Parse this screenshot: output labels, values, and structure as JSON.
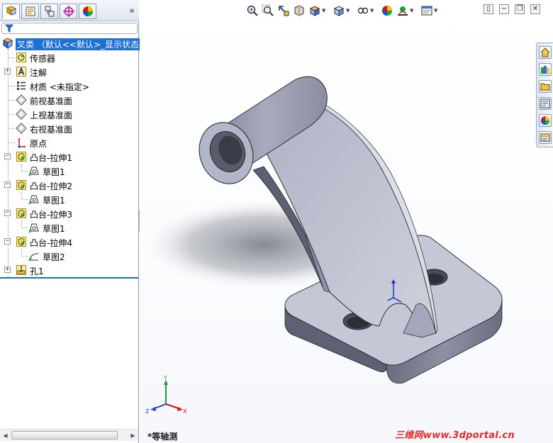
{
  "tabs": [
    {
      "name": "featuremanager-tab",
      "icon": "feature-tree-icon"
    },
    {
      "name": "propertymanager-tab",
      "icon": "property-icon"
    },
    {
      "name": "configuration-tab",
      "icon": "configuration-icon"
    },
    {
      "name": "dimxpert-tab",
      "icon": "dimxpert-icon"
    },
    {
      "name": "appearance-tab",
      "icon": "appearance-icon"
    }
  ],
  "tree": {
    "root_label": "叉类 （默认<<默认>_显示状态",
    "items": [
      {
        "label": "传感器",
        "icon": "sensor-icon",
        "level": 1,
        "expander": false
      },
      {
        "label": "注解",
        "icon": "annotation-icon",
        "level": 1,
        "expander": true
      },
      {
        "label": "材质 <未指定>",
        "icon": "material-icon",
        "level": 1,
        "expander": false
      },
      {
        "label": "前视基准面",
        "icon": "plane-icon",
        "level": 1,
        "expander": false
      },
      {
        "label": "上视基准面",
        "icon": "plane-icon",
        "level": 1,
        "expander": false
      },
      {
        "label": "右视基准面",
        "icon": "plane-icon",
        "level": 1,
        "expander": false
      },
      {
        "label": "原点",
        "icon": "origin-icon",
        "level": 1,
        "expander": false
      },
      {
        "label": "凸台-拉伸1",
        "icon": "extrude-icon",
        "level": 1,
        "expander": true
      },
      {
        "label": "草图1",
        "icon": "sketch-icon",
        "level": 2,
        "expander": false
      },
      {
        "label": "凸台-拉伸2",
        "icon": "extrude-icon",
        "level": 1,
        "expander": true
      },
      {
        "label": "草图1",
        "icon": "sketch-icon",
        "level": 2,
        "expander": false
      },
      {
        "label": "凸台-拉伸3",
        "icon": "extrude-icon",
        "level": 1,
        "expander": true
      },
      {
        "label": "草图1",
        "icon": "sketch-icon",
        "level": 2,
        "expander": false
      },
      {
        "label": "凸台-拉伸4",
        "icon": "extrude-icon",
        "level": 1,
        "expander": true
      },
      {
        "label": "草图2",
        "icon": "sketch-icon",
        "level": 2,
        "expander": false
      },
      {
        "label": "孔1",
        "icon": "hole-icon",
        "level": 1,
        "expander": true
      }
    ]
  },
  "viewport": {
    "view_name": "*等轴测",
    "watermark": "三维网www.3dportal.cn",
    "triad_labels": {
      "x": "X",
      "y": "Y",
      "z": "Z"
    }
  },
  "colors": {
    "selection": "#1e6fd8",
    "model_face": "#b9bccd",
    "model_dark": "#6e7184",
    "watermark": "#e32b2b"
  }
}
